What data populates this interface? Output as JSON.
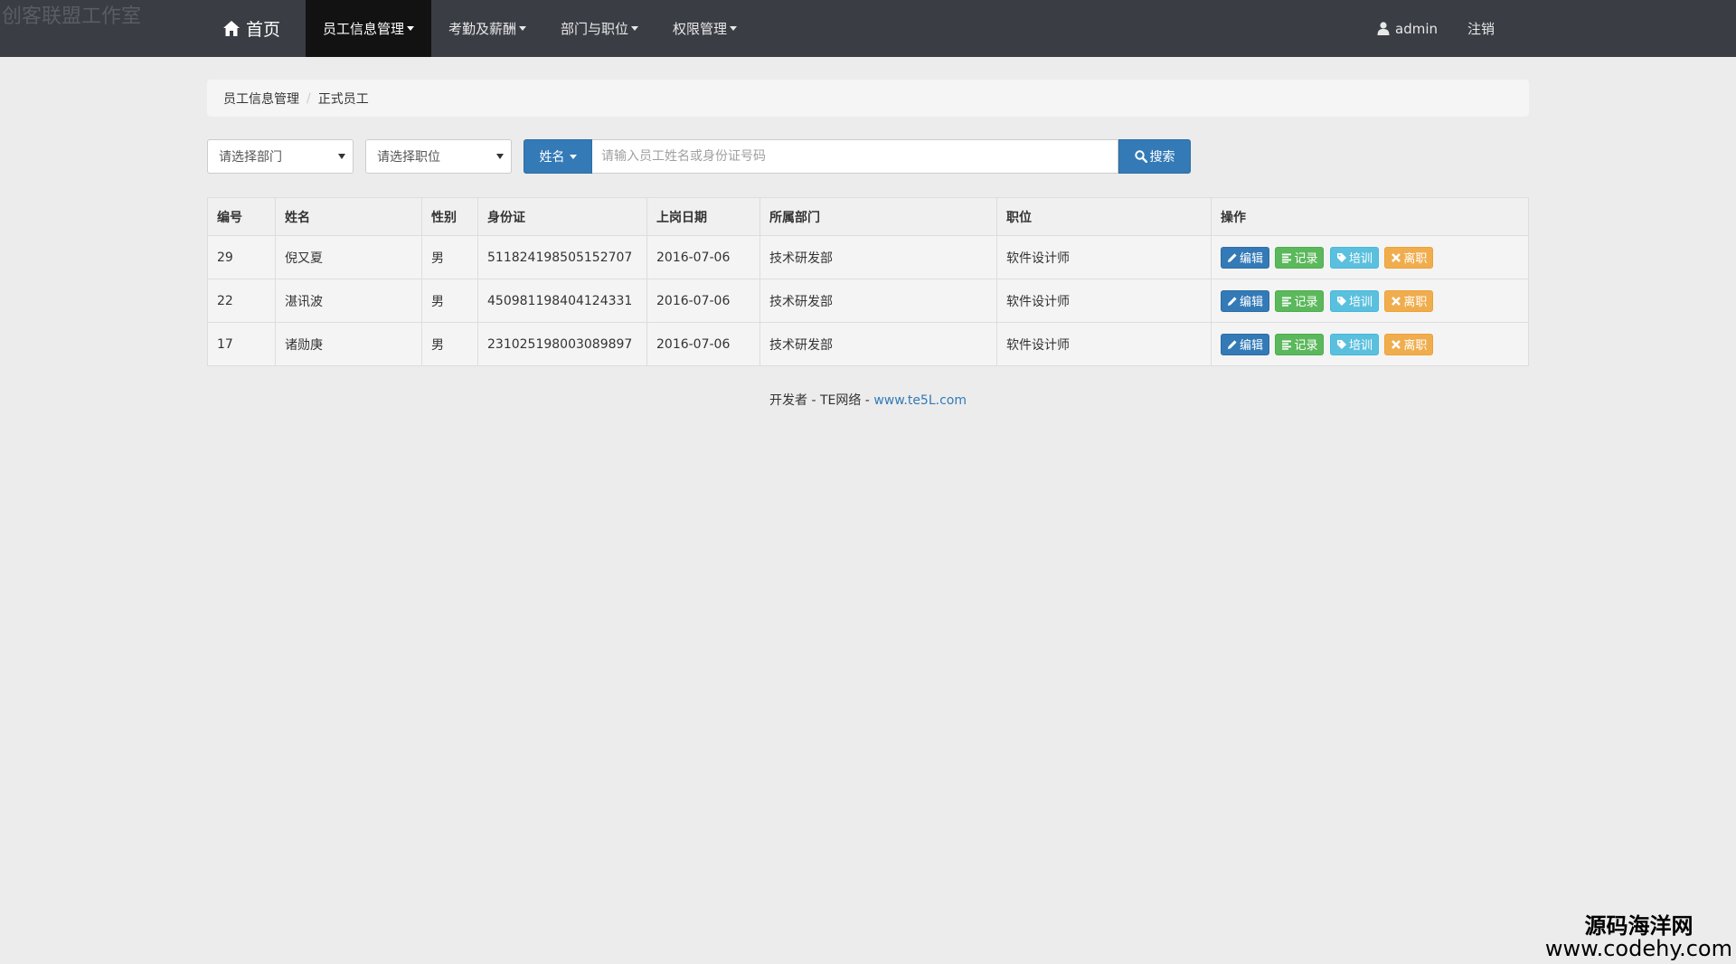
{
  "watermark_top": "创客联盟工作室",
  "navbar": {
    "brand": "首页",
    "menu": [
      {
        "label": "员工信息管理",
        "active": true
      },
      {
        "label": "考勤及薪酬",
        "active": false
      },
      {
        "label": "部门与职位",
        "active": false
      },
      {
        "label": "权限管理",
        "active": false
      }
    ],
    "user": "admin",
    "logout": "注销"
  },
  "breadcrumb": {
    "parent": "员工信息管理",
    "current": "正式员工"
  },
  "filters": {
    "department_placeholder": "请选择部门",
    "position_placeholder": "请选择职位",
    "field_selector": "姓名",
    "search_placeholder": "请输入员工姓名或身份证号码",
    "search_button": "搜索"
  },
  "table": {
    "headers": [
      "编号",
      "姓名",
      "性别",
      "身份证",
      "上岗日期",
      "所属部门",
      "职位",
      "操作"
    ],
    "rows": [
      {
        "id": "29",
        "name": "倪又夏",
        "gender": "男",
        "id_card": "511824198505152707",
        "date": "2016-07-06",
        "dept": "技术研发部",
        "position": "软件设计师"
      },
      {
        "id": "22",
        "name": "湛讯波",
        "gender": "男",
        "id_card": "450981198404124331",
        "date": "2016-07-06",
        "dept": "技术研发部",
        "position": "软件设计师"
      },
      {
        "id": "17",
        "name": "诸勋庚",
        "gender": "男",
        "id_card": "231025198003089897",
        "date": "2016-07-06",
        "dept": "技术研发部",
        "position": "软件设计师"
      }
    ],
    "actions": {
      "edit": "编辑",
      "record": "记录",
      "train": "培训",
      "leave": "离职"
    }
  },
  "footer": {
    "prefix": "开发者 - TE网络 - ",
    "link": "www.te5L.com"
  },
  "watermark_br": {
    "line1": "源码海洋网",
    "line2": "www.codehy.com"
  },
  "colors": {
    "navbar": "#3a3d44",
    "primary": "#337ab7",
    "success": "#5cb85c",
    "info": "#5bc0de",
    "warning": "#f0ad4e"
  }
}
